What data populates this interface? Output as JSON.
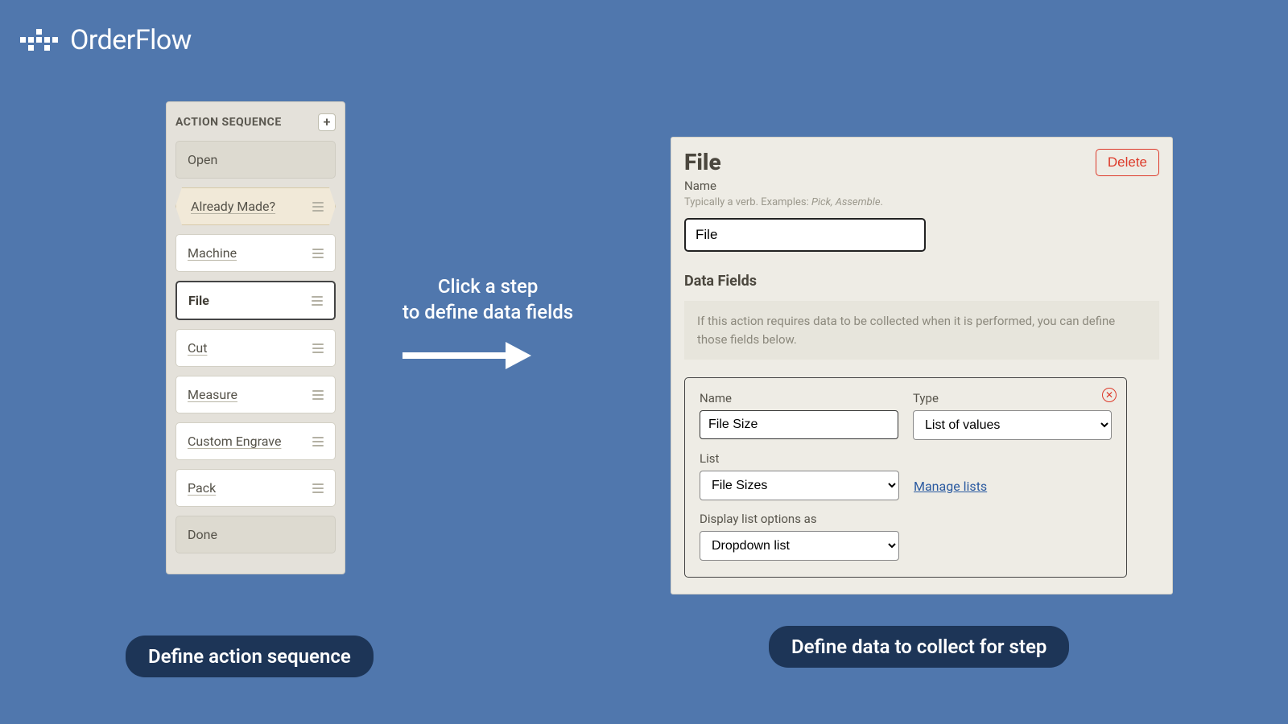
{
  "logo": {
    "text": "OrderFlow"
  },
  "sequence": {
    "title": "ACTION SEQUENCE",
    "items": [
      {
        "label": "Open",
        "kind": "static"
      },
      {
        "label": "Already Made?",
        "kind": "decision"
      },
      {
        "label": "Machine",
        "kind": "normal"
      },
      {
        "label": "File",
        "kind": "selected"
      },
      {
        "label": "Cut",
        "kind": "normal"
      },
      {
        "label": "Measure",
        "kind": "normal"
      },
      {
        "label": "Custom Engrave",
        "kind": "normal"
      },
      {
        "label": "Pack",
        "kind": "normal"
      },
      {
        "label": "Done",
        "kind": "static"
      }
    ]
  },
  "center": {
    "line1": "Click a step",
    "line2": "to define data fields"
  },
  "detail": {
    "title": "File",
    "delete": "Delete",
    "name_label": "Name",
    "name_hint_prefix": "Typically a verb. Examples: ",
    "name_hint_em": "Pick, Assemble",
    "name_value": "File",
    "section": "Data Fields",
    "info": "If this action requires data to be collected when it is performed, you can define those fields below.",
    "field": {
      "name_label": "Name",
      "name_value": "File Size",
      "type_label": "Type",
      "type_value": "List of values",
      "list_label": "List",
      "list_value": "File Sizes",
      "manage_lists": "Manage lists",
      "display_label": "Display list options as",
      "display_value": "Dropdown list"
    }
  },
  "captions": {
    "left": "Define action sequence",
    "right": "Define data to collect for step"
  }
}
